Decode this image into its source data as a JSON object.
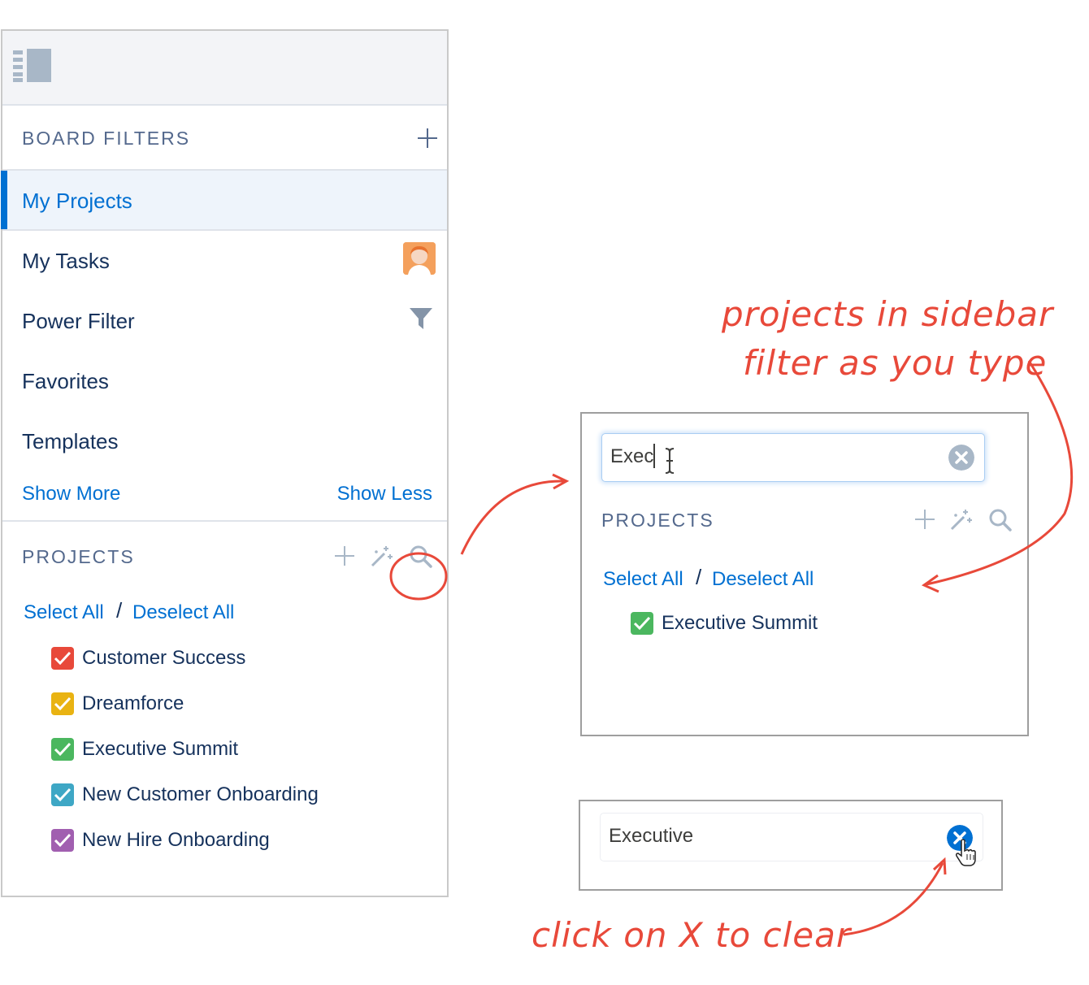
{
  "sidebar": {
    "board_filters_title": "BOARD FILTERS",
    "nav": [
      {
        "label": "My Projects",
        "active": true
      },
      {
        "label": "My Tasks"
      },
      {
        "label": "Power Filter"
      },
      {
        "label": "Favorites"
      },
      {
        "label": "Templates"
      }
    ],
    "show_more": "Show More",
    "show_less": "Show Less",
    "projects_title": "PROJECTS",
    "select_all": "Select All",
    "separator": "/",
    "deselect_all": "Deselect All",
    "projects": [
      {
        "name": "Customer Success",
        "color": "#e8493a"
      },
      {
        "name": "Dreamforce",
        "color": "#e9b312"
      },
      {
        "name": "Executive Summit",
        "color": "#4bb75f"
      },
      {
        "name": "New Customer Onboarding",
        "color": "#3ea7c5"
      },
      {
        "name": "New Hire Onboarding",
        "color": "#a15fb0"
      }
    ]
  },
  "filter_panel": {
    "search_value": "Exec",
    "projects_title": "PROJECTS",
    "select_all": "Select All",
    "separator": "/",
    "deselect_all": "Deselect All",
    "result": {
      "name": "Executive Summit",
      "color": "#4bb75f"
    }
  },
  "clear_panel": {
    "search_value": "Executive"
  },
  "annotations": {
    "line1": "projects in sidebar",
    "line2": "filter as you type",
    "clear": "click on X to clear"
  },
  "colors": {
    "accent": "#0070d2",
    "annotation": "#e8493a"
  }
}
